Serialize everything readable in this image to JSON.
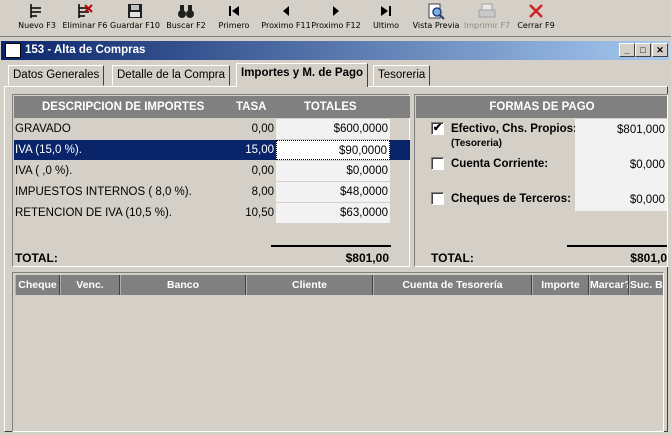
{
  "toolbar": {
    "items": [
      {
        "label": "Nuevo F3",
        "icon": "new-record-icon",
        "enabled": true
      },
      {
        "label": "Eliminar F6",
        "icon": "delete-record-icon",
        "enabled": true
      },
      {
        "label": "Guardar F10",
        "icon": "save-icon",
        "enabled": true
      },
      {
        "label": "Buscar F2",
        "icon": "binoculars-icon",
        "enabled": true
      },
      {
        "label": "Primero",
        "icon": "first-icon",
        "enabled": true
      },
      {
        "label": "Proximo F11",
        "icon": "previous-icon",
        "enabled": true
      },
      {
        "label": "Proximo F12",
        "icon": "next-icon",
        "enabled": true
      },
      {
        "label": "Ultimo",
        "icon": "last-icon",
        "enabled": true
      },
      {
        "label": "Vista Previa",
        "icon": "preview-icon",
        "enabled": true
      },
      {
        "label": "Imprimir F7",
        "icon": "printer-icon",
        "enabled": false
      },
      {
        "label": "Cerrar F9",
        "icon": "close-x-icon",
        "enabled": true
      }
    ]
  },
  "window": {
    "title": "153 - Alta de Compras",
    "buttons": {
      "minimize": "_",
      "maximize": "□",
      "close": "✕"
    }
  },
  "tabs": [
    {
      "label": "Datos Generales",
      "active": false
    },
    {
      "label": "Detalle de la Compra",
      "active": false
    },
    {
      "label": "Importes y M. de Pago",
      "active": true
    },
    {
      "label": "Tesoreria",
      "active": false
    }
  ],
  "importes": {
    "headers": {
      "descripcion": "DESCRIPCION DE IMPORTES",
      "tasa": "TASA",
      "totales": "TOTALES"
    },
    "rows": [
      {
        "descripcion": "GRAVADO",
        "tasa": "0,00",
        "total": "$600,0000",
        "selected": false
      },
      {
        "descripcion": "IVA  (15,0 %).",
        "tasa": "15,00",
        "total": "$90,0000",
        "selected": true
      },
      {
        "descripcion": "IVA  ( ,0 %).",
        "tasa": "0,00",
        "total": "$0,0000",
        "selected": false
      },
      {
        "descripcion": "IMPUESTOS INTERNOS  ( 8,0 %).",
        "tasa": "8,00",
        "total": "$48,0000",
        "selected": false
      },
      {
        "descripcion": "RETENCION DE IVA  (10,5 %).",
        "tasa": "10,50",
        "total": "$63,0000",
        "selected": false
      }
    ],
    "total_label": "TOTAL:",
    "total_value": "$801,00"
  },
  "formas_pago": {
    "header": "FORMAS DE PAGO",
    "items": [
      {
        "label": "Efectivo, Chs. Propios:",
        "sublabel": "(Tesoreria)",
        "checked": true,
        "value": "$801,000"
      },
      {
        "label": "Cuenta Corriente:",
        "sublabel": "",
        "checked": false,
        "value": "$0,000"
      },
      {
        "label": "Cheques de Terceros:",
        "sublabel": "",
        "checked": false,
        "value": "$0,000"
      }
    ],
    "total_label": "TOTAL:",
    "total_value": "$801,0"
  },
  "grid": {
    "columns": [
      "Cheque",
      "Venc.",
      "Banco",
      "Cliente",
      "Cuenta de Tesorería",
      "Importe",
      "Marcar?",
      "Suc. B"
    ]
  },
  "colors": {
    "selection": "#0a246a",
    "header_gray": "#808080",
    "face": "#d4d0c8",
    "close_red": "#d42020"
  }
}
